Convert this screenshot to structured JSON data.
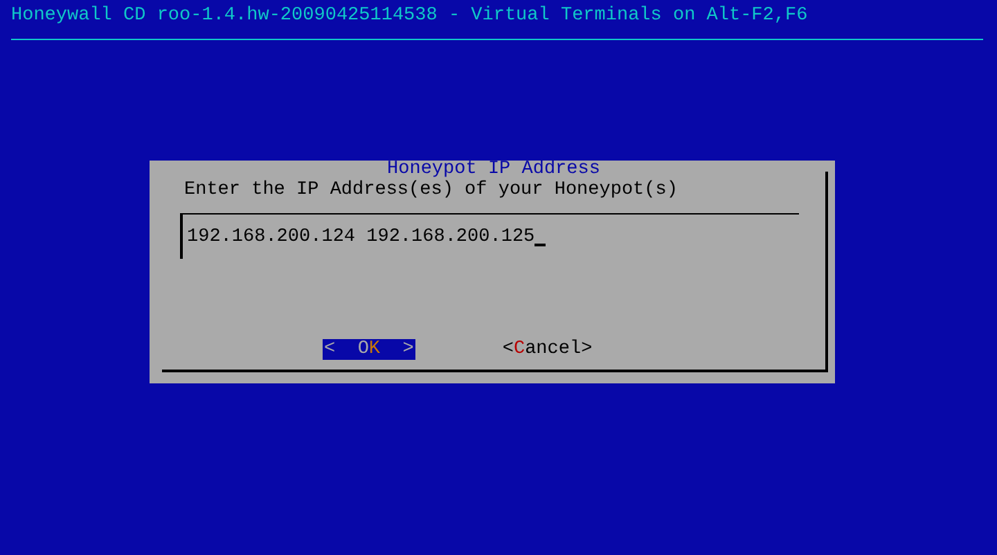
{
  "header": {
    "title": "Honeywall CD roo-1.4.hw-20090425114538 - Virtual Terminals on Alt-F2,F6"
  },
  "dialog": {
    "title": "Honeypot IP Address",
    "prompt": "Enter the IP Address(es) of your Honeypot(s)",
    "input": {
      "value": "192.168.200.124 192.168.200.125"
    },
    "buttons": [
      {
        "left": "<",
        "right": ">",
        "selected": true,
        "parts": [
          {
            "text": "O",
            "hotkey": false
          },
          {
            "text": "K",
            "hotkey": true
          }
        ]
      },
      {
        "left": "<",
        "right": ">",
        "selected": false,
        "parts": [
          {
            "text": "C",
            "hotkey": true
          },
          {
            "text": "ancel",
            "hotkey": false
          }
        ]
      }
    ]
  }
}
